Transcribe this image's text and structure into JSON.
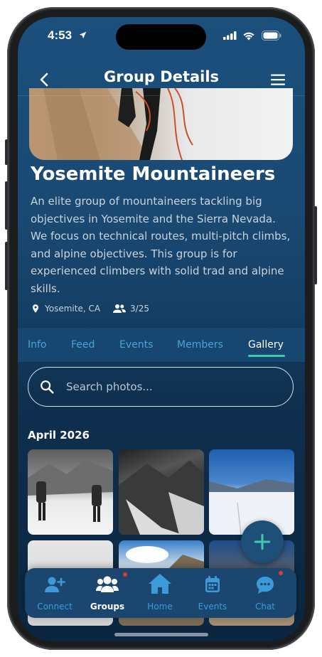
{
  "status_bar": {
    "time": "4:53"
  },
  "header": {
    "title": "Group Details"
  },
  "group": {
    "name": "Yosemite Mountaineers",
    "description": "An elite group of mountaineers tackling big objectives in Yosemite and the Sierra Nevada. We focus on technical routes, multi-pitch climbs, and alpine objectives. This group is for experienced climbers with solid trad and alpine skills.",
    "location": "Yosemite, CA",
    "members_count": "3/25"
  },
  "tabs": [
    {
      "label": "Info"
    },
    {
      "label": "Feed"
    },
    {
      "label": "Events"
    },
    {
      "label": "Members"
    },
    {
      "label": "Gallery",
      "active": true
    }
  ],
  "search": {
    "placeholder": "Search photos..."
  },
  "gallery": {
    "section_title": "April 2026"
  },
  "bottom_nav": [
    {
      "label": "Connect",
      "icon": "add-person-icon"
    },
    {
      "label": "Groups",
      "icon": "groups-icon",
      "active": true,
      "badge": true
    },
    {
      "label": "Home",
      "icon": "home-icon"
    },
    {
      "label": "Events",
      "icon": "calendar-icon"
    },
    {
      "label": "Chat",
      "icon": "chat-icon",
      "badge": true
    }
  ],
  "colors": {
    "accent": "#3cc8b0",
    "tab_inactive": "#4aa3d6",
    "nav_inactive": "#3d9ad8",
    "badge": "#e53935"
  }
}
